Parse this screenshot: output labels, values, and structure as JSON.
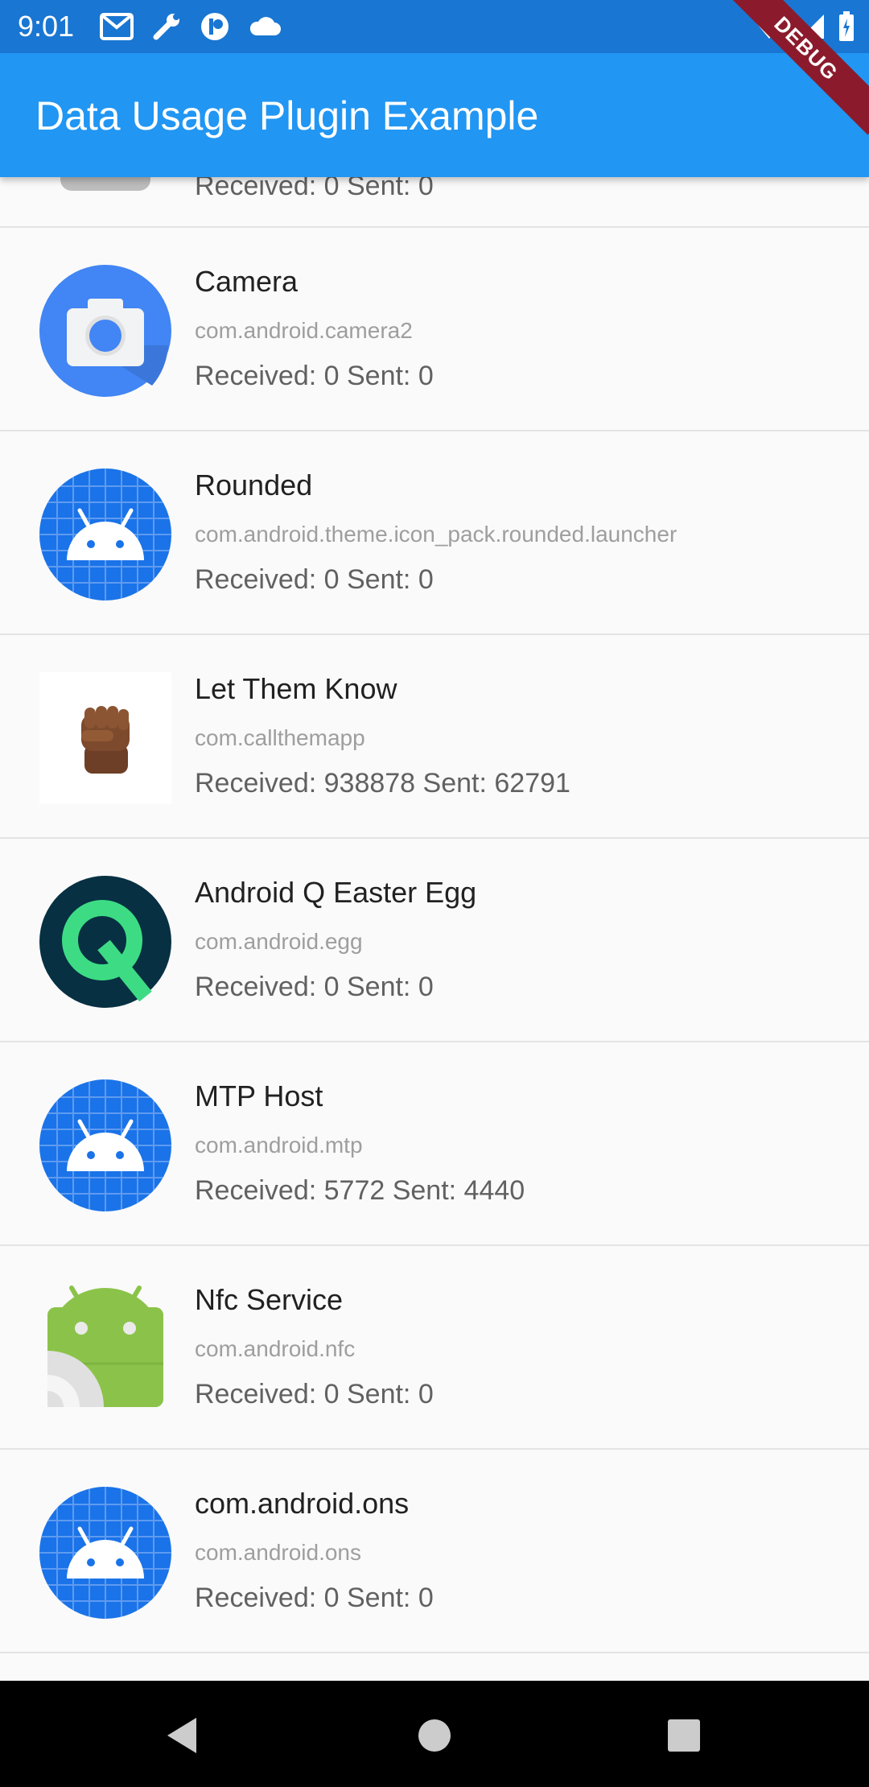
{
  "status_bar": {
    "time": "9:01",
    "left_icons": [
      "gmail-icon",
      "wrench-icon",
      "app-icon",
      "cloud-icon"
    ],
    "right_icons": [
      "wifi-icon",
      "signal-icon",
      "battery-icon"
    ]
  },
  "app_bar": {
    "title": "Data Usage Plugin Example",
    "color": "#2196f3"
  },
  "debug_banner": {
    "label": "DEBUG"
  },
  "apps": [
    {
      "usage": "Received: 0  Sent: 0",
      "icon": "partial-icon"
    },
    {
      "name": "Camera",
      "package": "com.android.camera2",
      "usage": "Received: 0  Sent: 0",
      "icon": "camera-icon"
    },
    {
      "name": "Rounded",
      "package": "com.android.theme.icon_pack.rounded.launcher",
      "usage": "Received: 0  Sent: 0",
      "icon": "android-icon"
    },
    {
      "name": "Let Them Know",
      "package": "com.callthemapp",
      "usage": "Received: 938878  Sent: 62791",
      "icon": "fist-icon"
    },
    {
      "name": "Android Q Easter Egg",
      "package": "com.android.egg",
      "usage": "Received: 0  Sent: 0",
      "icon": "android-q-icon"
    },
    {
      "name": "MTP Host",
      "package": "com.android.mtp",
      "usage": "Received: 5772  Sent: 4440",
      "icon": "android-icon"
    },
    {
      "name": "Nfc Service",
      "package": "com.android.nfc",
      "usage": "Received: 0  Sent: 0",
      "icon": "nfc-android-icon"
    },
    {
      "name": "com.android.ons",
      "package": "com.android.ons",
      "usage": "Received: 0  Sent: 0",
      "icon": "android-icon"
    }
  ],
  "nav_bar": {
    "buttons": [
      "back-icon",
      "home-icon",
      "recents-icon"
    ]
  }
}
